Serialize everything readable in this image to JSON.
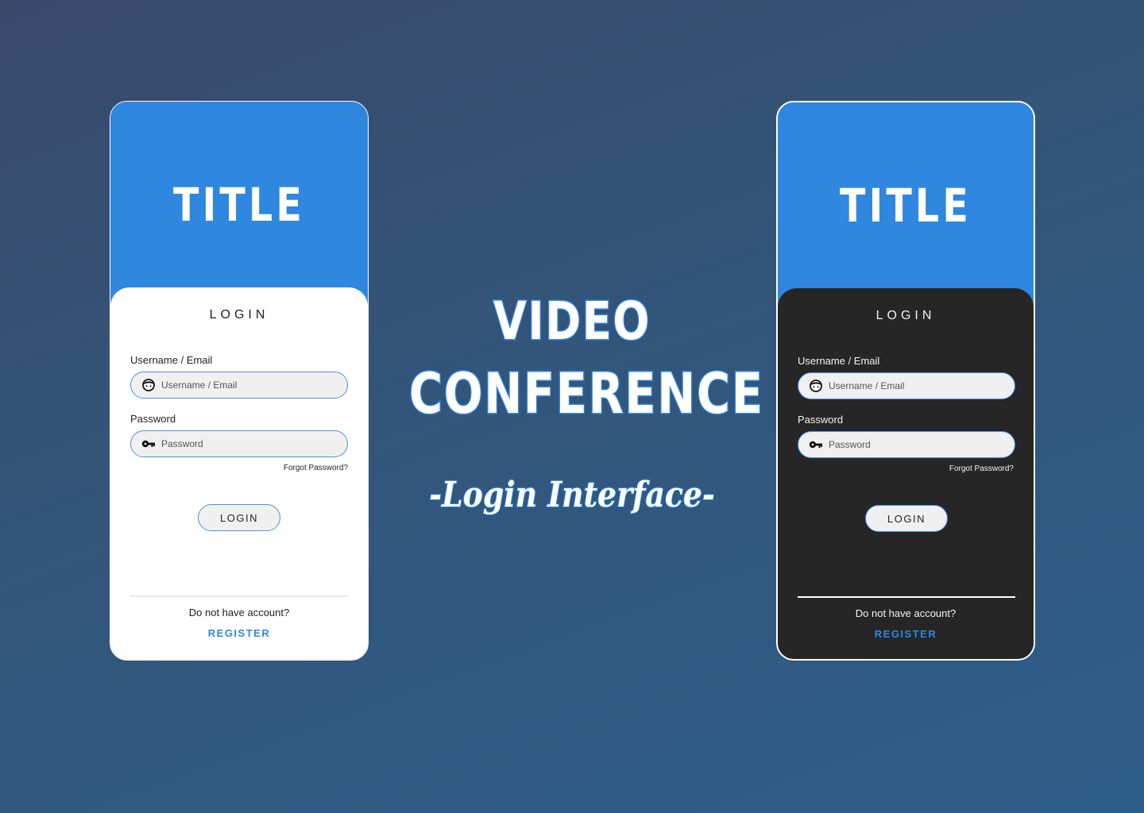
{
  "headline": {
    "line1": "VIDEO",
    "line2": "CONFERENCE",
    "subtitle": "-Login Interface-"
  },
  "colors": {
    "accent": "#2f87e0",
    "light_panel": "#ffffff",
    "dark_panel": "#262626",
    "input_bg": "#f0f0f0",
    "input_border": "#4a90e2"
  },
  "light_screen": {
    "title": "TITLE",
    "panel_title": "LOGIN",
    "username_label": "Username / Email",
    "username_placeholder": "Username / Email",
    "password_label": "Password",
    "password_placeholder": "Password",
    "forgot_password": "Forgot Password?",
    "login_button": "LOGIN",
    "no_account": "Do not have account?",
    "register_link": "REGISTER",
    "user_icon": "user-face-icon",
    "key_icon": "key-icon"
  },
  "dark_screen": {
    "title": "TITLE",
    "panel_title": "LOGIN",
    "username_label": "Username / Email",
    "username_placeholder": "Username / Email",
    "password_label": "Password",
    "password_placeholder": "Password",
    "forgot_password": "Forgot Password?",
    "login_button": "LOGIN",
    "no_account": "Do not have account?",
    "register_link": "REGISTER",
    "user_icon": "user-face-icon",
    "key_icon": "key-icon"
  }
}
